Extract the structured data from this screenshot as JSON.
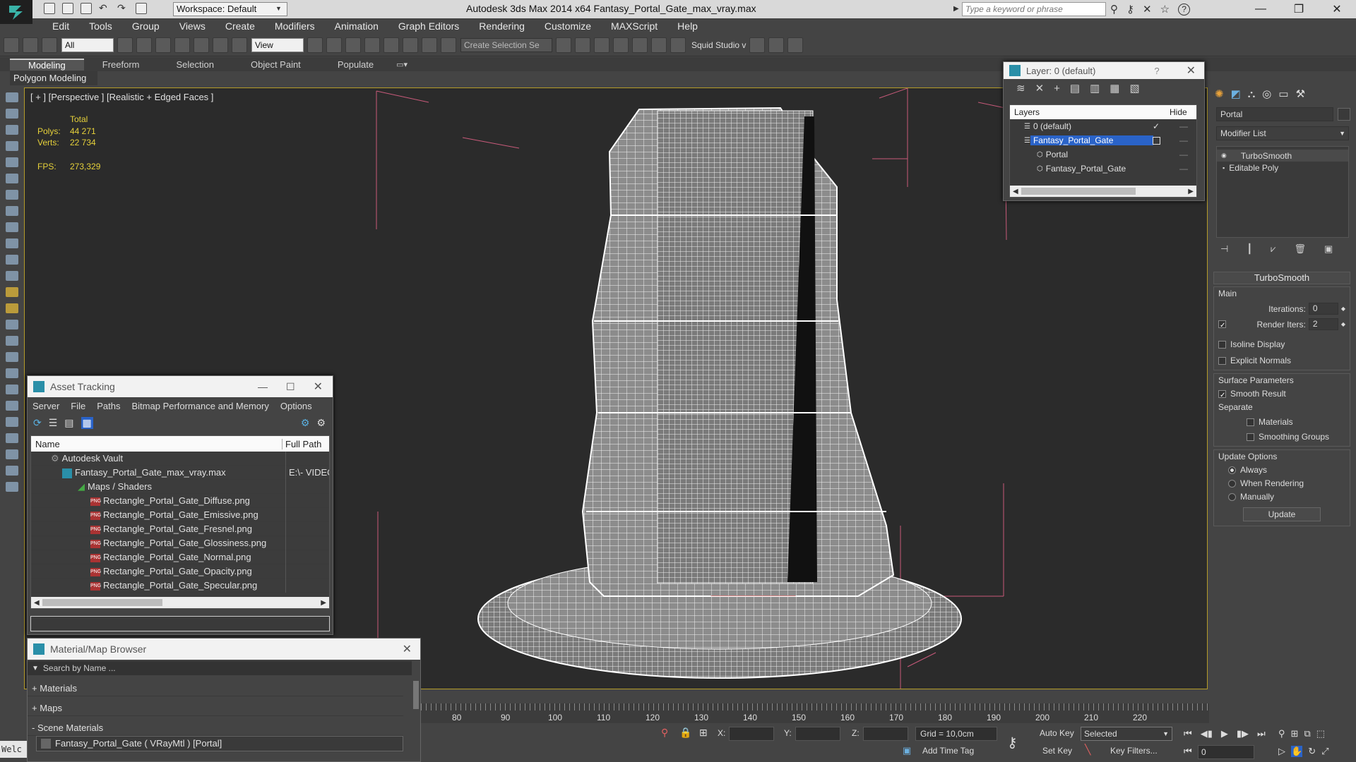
{
  "titlebar": {
    "workspace": "Workspace: Default",
    "app_title": "Autodesk 3ds Max  2014 x64     Fantasy_Portal_Gate_max_vray.max",
    "search_placeholder": "Type a keyword or phrase"
  },
  "menu": [
    "Edit",
    "Tools",
    "Group",
    "Views",
    "Create",
    "Modifiers",
    "Animation",
    "Graph Editors",
    "Rendering",
    "Customize",
    "MAXScript",
    "Help"
  ],
  "toolbar": {
    "selection_filter": "All",
    "ref_coord": "View",
    "named_selection": "Create Selection Se",
    "squid": "Squid Studio v"
  },
  "ribbon": {
    "tabs": [
      "Modeling",
      "Freeform",
      "Selection",
      "Object Paint",
      "Populate"
    ],
    "active_tab": "Modeling",
    "panel_label": "Polygon Modeling"
  },
  "viewport": {
    "label": "[ + ] [Perspective ] [Realistic + Edged Faces ]",
    "total_label": "Total",
    "polys_label": "Polys:",
    "polys_value": "44 271",
    "verts_label": "Verts:",
    "verts_value": "22 734",
    "fps_label": "FPS:",
    "fps_value": "273,329"
  },
  "layer_window": {
    "title": "Layer: 0 (default)",
    "col_layers": "Layers",
    "col_hide": "Hide",
    "rows": [
      {
        "name": "0 (default)",
        "indent": 0
      },
      {
        "name": "Fantasy_Portal_Gate",
        "indent": 0
      },
      {
        "name": "Portal",
        "indent": 1
      },
      {
        "name": "Fantasy_Portal_Gate",
        "indent": 1
      }
    ]
  },
  "command_panel": {
    "object_name": "Portal",
    "modifier_list": "Modifier List",
    "stack": [
      "TurboSmooth",
      "Editable Poly"
    ],
    "rollout_title": "TurboSmooth",
    "main_label": "Main",
    "iterations_label": "Iterations:",
    "iterations_value": "0",
    "render_iters_label": "Render Iters:",
    "render_iters_value": "2",
    "isoline": "Isoline Display",
    "explicit": "Explicit Normals",
    "surface_label": "Surface Parameters",
    "smooth_result": "Smooth Result",
    "separate_label": "Separate",
    "materials": "Materials",
    "smoothing_groups": "Smoothing Groups",
    "update_label": "Update Options",
    "always": "Always",
    "when_rendering": "When Rendering",
    "manually": "Manually",
    "update_button": "Update"
  },
  "asset_window": {
    "title": "Asset Tracking",
    "menu": [
      "Server",
      "File",
      "Paths",
      "Bitmap Performance and Memory",
      "Options"
    ],
    "col_name": "Name",
    "col_path": "Full Path",
    "vault": "Autodesk Vault",
    "file": "Fantasy_Portal_Gate_max_vray.max",
    "file_path": "E:\\- VIDEO",
    "maps_folder": "Maps / Shaders",
    "maps": [
      "Rectangle_Portal_Gate_Diffuse.png",
      "Rectangle_Portal_Gate_Emissive.png",
      "Rectangle_Portal_Gate_Fresnel.png",
      "Rectangle_Portal_Gate_Glossiness.png",
      "Rectangle_Portal_Gate_Normal.png",
      "Rectangle_Portal_Gate_Opacity.png",
      "Rectangle_Portal_Gate_Specular.png"
    ],
    "png_badge": "PNG"
  },
  "material_window": {
    "title": "Material/Map Browser",
    "search_placeholder": "Search by Name ...",
    "groups": [
      "+ Materials",
      "+ Maps",
      "- Scene Materials"
    ],
    "scene_material": "Fantasy_Portal_Gate  ( VRayMtl )  [Portal]"
  },
  "timeline": {
    "ticks": [
      "80",
      "90",
      "100",
      "110",
      "120",
      "130",
      "140",
      "150",
      "160",
      "170",
      "180",
      "190",
      "200",
      "210",
      "220"
    ]
  },
  "status": {
    "x_label": "X:",
    "y_label": "Y:",
    "z_label": "Z:",
    "grid": "Grid = 10,0cm",
    "add_time_tag": "Add Time Tag",
    "auto_key": "Auto Key",
    "set_key": "Set Key",
    "selected": "Selected",
    "key_filters": "Key Filters...",
    "frame": "0",
    "prompt": "Welc"
  }
}
